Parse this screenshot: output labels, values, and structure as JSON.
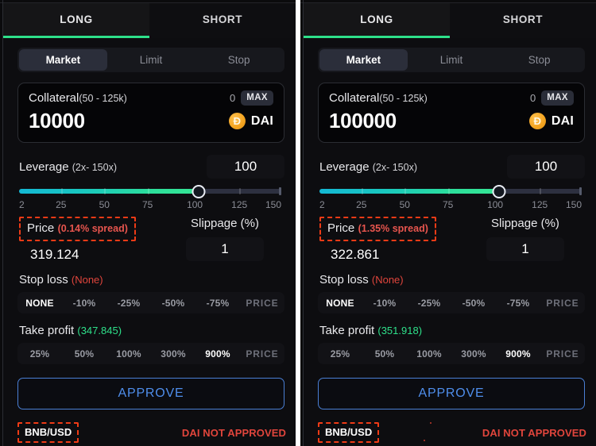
{
  "panels": [
    {
      "id": "left",
      "direction_tabs": [
        {
          "label": "LONG",
          "active": true
        },
        {
          "label": "SHORT",
          "active": false
        }
      ],
      "order_types": [
        {
          "label": "Market",
          "active": true
        },
        {
          "label": "Limit",
          "active": false
        },
        {
          "label": "Stop",
          "active": false
        }
      ],
      "collateral": {
        "label": "Collateral",
        "range": "(50 - 125k)",
        "balance": "0",
        "max_label": "MAX",
        "amount": "10000",
        "token": "DAI",
        "token_icon": "dai-coin-icon",
        "token_glyph": "Ð"
      },
      "leverage": {
        "label": "Leverage",
        "range": "(2x- 150x)",
        "value": "100",
        "ticks": [
          "2",
          "25",
          "50",
          "75",
          "100",
          "125",
          "150"
        ],
        "fill_percent": 68.5
      },
      "price": {
        "label": "Price",
        "spread": "(0.14% spread)",
        "value": "319.124",
        "highlighted": true
      },
      "slippage": {
        "label": "Slippage (%)",
        "value": "1"
      },
      "stop_loss": {
        "label": "Stop loss",
        "value": "(None)",
        "options": [
          "NONE",
          "-10%",
          "-25%",
          "-50%",
          "-75%",
          "PRICE"
        ],
        "active_index": 0
      },
      "take_profit": {
        "label": "Take profit",
        "value": "(347.845)",
        "options": [
          "25%",
          "50%",
          "100%",
          "300%",
          "900%",
          "PRICE"
        ],
        "active_index": 4
      },
      "approve_label": "APPROVE",
      "footer": {
        "pair": "BNB/USD",
        "status": "DAI NOT APPROVED",
        "pair_highlighted": true
      }
    },
    {
      "id": "right",
      "direction_tabs": [
        {
          "label": "LONG",
          "active": true
        },
        {
          "label": "SHORT",
          "active": false
        }
      ],
      "order_types": [
        {
          "label": "Market",
          "active": true
        },
        {
          "label": "Limit",
          "active": false
        },
        {
          "label": "Stop",
          "active": false
        }
      ],
      "collateral": {
        "label": "Collateral",
        "range": "(50 - 125k)",
        "balance": "0",
        "max_label": "MAX",
        "amount": "100000",
        "token": "DAI",
        "token_icon": "dai-coin-icon",
        "token_glyph": "Ð"
      },
      "leverage": {
        "label": "Leverage",
        "range": "(2x- 150x)",
        "value": "100",
        "ticks": [
          "2",
          "25",
          "50",
          "75",
          "100",
          "125",
          "150"
        ],
        "fill_percent": 68.5
      },
      "price": {
        "label": "Price",
        "spread": "(1.35% spread)",
        "value": "322.861",
        "highlighted": true
      },
      "slippage": {
        "label": "Slippage (%)",
        "value": "1"
      },
      "stop_loss": {
        "label": "Stop loss",
        "value": "(None)",
        "options": [
          "NONE",
          "-10%",
          "-25%",
          "-50%",
          "-75%",
          "PRICE"
        ],
        "active_index": 0
      },
      "take_profit": {
        "label": "Take profit",
        "value": "(351.918)",
        "options": [
          "25%",
          "50%",
          "100%",
          "300%",
          "900%",
          "PRICE"
        ],
        "active_index": 4
      },
      "approve_label": "APPROVE",
      "footer": {
        "pair": "BNB/USD",
        "status": "DAI NOT APPROVED",
        "pair_highlighted": true
      }
    }
  ],
  "colors": {
    "accent_long": "#2ee08a",
    "accent_approve": "#4f8eec",
    "danger": "#e0453c",
    "annotation": "#ef3b16",
    "token_dai": "#f5a623",
    "slider_start": "#14b8d4",
    "slider_end": "#35e695",
    "panel_bg": "#0d0d10"
  }
}
